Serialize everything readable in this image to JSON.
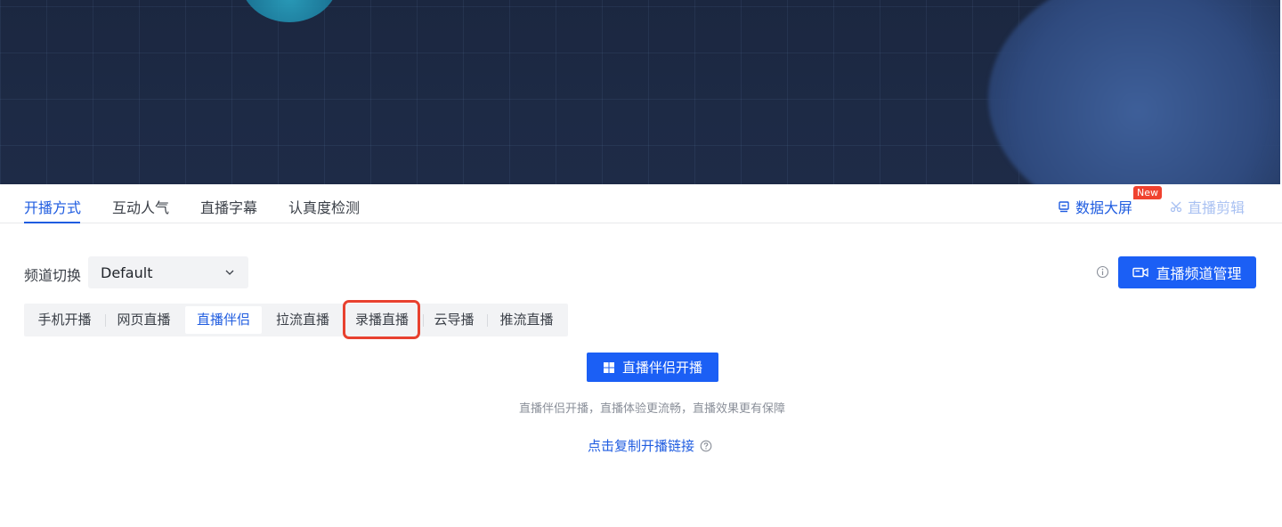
{
  "tabs": [
    {
      "label": "开播方式",
      "active": true
    },
    {
      "label": "互动人气",
      "active": false
    },
    {
      "label": "直播字幕",
      "active": false
    },
    {
      "label": "认真度检测",
      "active": false
    }
  ],
  "header_links": {
    "data_screen": {
      "label": "数据大屏",
      "icon": "monitor-icon",
      "badge": "New"
    },
    "live_clip": {
      "label": "直播剪辑",
      "icon": "scissors-icon",
      "disabled": true
    }
  },
  "channel": {
    "label": "频道切换",
    "selected": "Default",
    "manage_button": "直播频道管理"
  },
  "modes": [
    {
      "label": "手机开播",
      "active": false
    },
    {
      "label": "网页直播",
      "active": false
    },
    {
      "label": "直播伴侣",
      "active": true
    },
    {
      "label": "拉流直播",
      "active": false
    },
    {
      "label": "录播直播",
      "active": false,
      "highlighted": true
    },
    {
      "label": "云导播",
      "active": false
    },
    {
      "label": "推流直播",
      "active": false
    }
  ],
  "launch": {
    "button": "直播伴侣开播",
    "hint": "直播伴侣开播，直播体验更流畅，直播效果更有保障",
    "copy_link": "点击复制开播链接"
  },
  "colors": {
    "accent": "#1b5ff5",
    "link": "#1f5ce0",
    "badge": "#f0422f",
    "highlight_border": "#e8412f",
    "banner": "#1d2a45"
  }
}
